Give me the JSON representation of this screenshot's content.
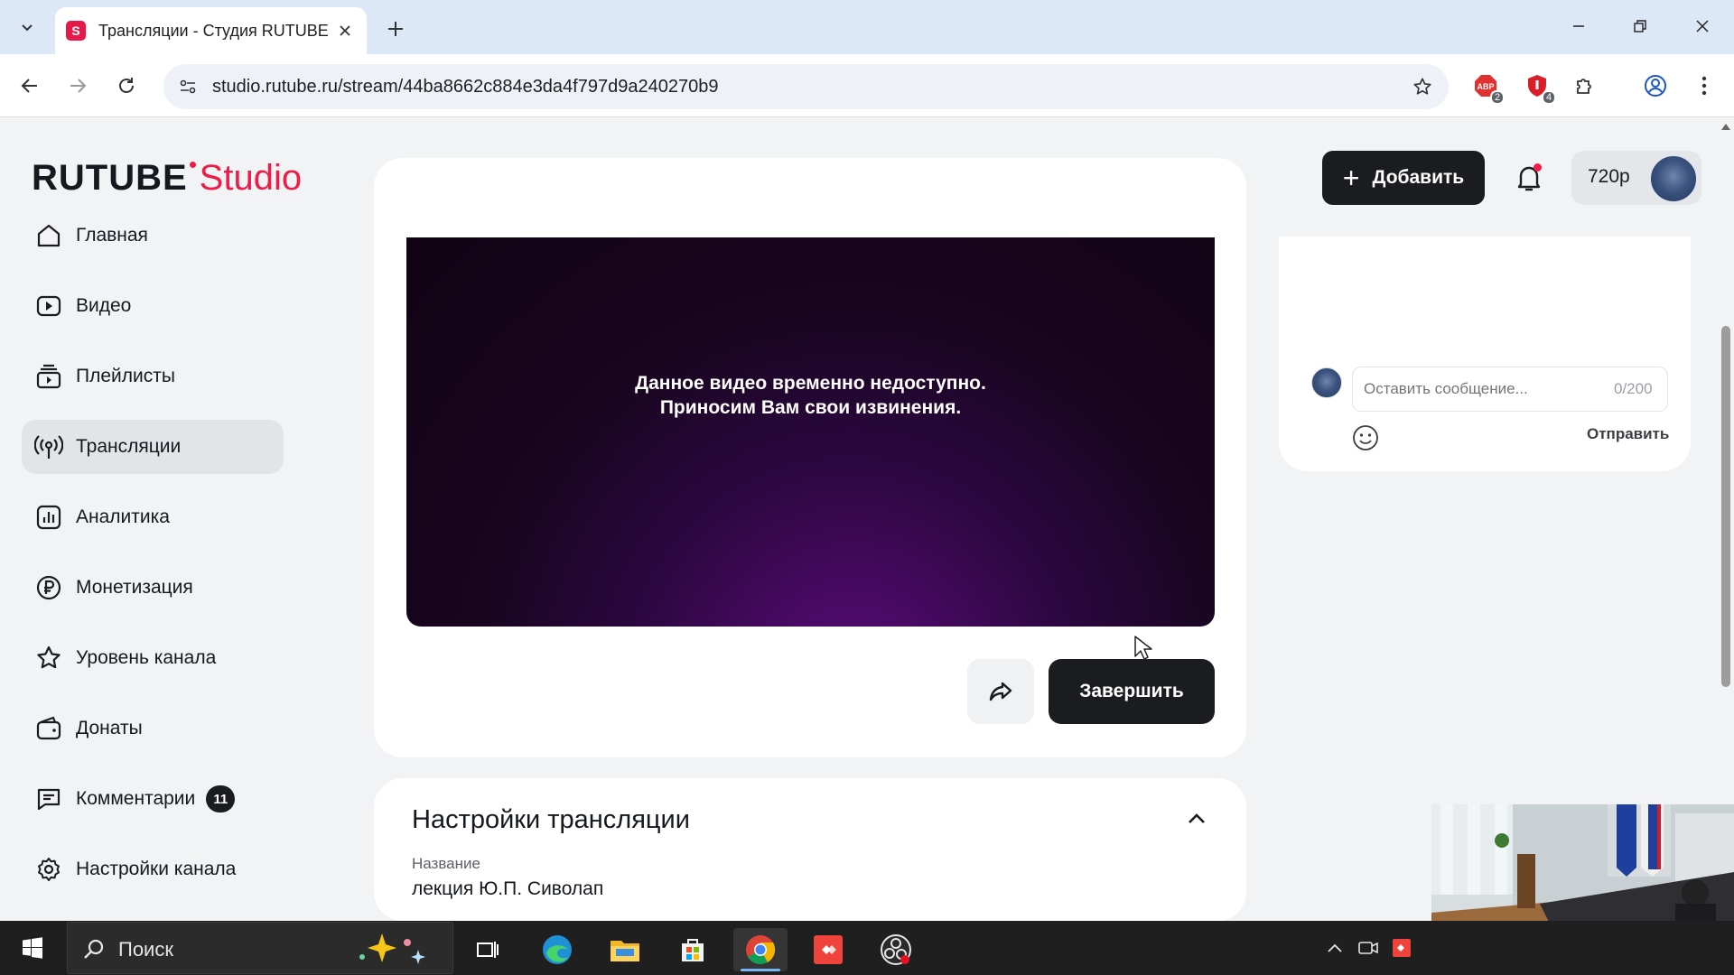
{
  "browser": {
    "tab_title": "Трансляции - Студия RUTUBE",
    "tab_favicon_letter": "S",
    "url": "studio.rutube.ru/stream/44ba8662c884e3da4f797d9a240270b9",
    "extensions": [
      {
        "name": "adblock-extension-icon",
        "badge": "2"
      },
      {
        "name": "shield-extension-icon",
        "badge": "4"
      }
    ]
  },
  "header": {
    "logo_main": "RUTUBE",
    "logo_studio": "Studio",
    "add_button": "Добавить",
    "profile_label": "720p"
  },
  "sidebar": {
    "items": [
      {
        "label": "Главная"
      },
      {
        "label": "Видео"
      },
      {
        "label": "Плейлисты"
      },
      {
        "label": "Трансляции",
        "active": true
      },
      {
        "label": "Аналитика"
      },
      {
        "label": "Монетизация"
      },
      {
        "label": "Уровень канала"
      },
      {
        "label": "Донаты"
      },
      {
        "label": "Комментарии",
        "badge": "11"
      },
      {
        "label": "Настройки канала"
      }
    ]
  },
  "video": {
    "message_line1": "Данное видео временно недоступно.",
    "message_line2": "Приносим Вам свои извинения."
  },
  "actions": {
    "finish_button": "Завершить"
  },
  "settings": {
    "title": "Настройки трансляции",
    "name_label": "Название",
    "name_value": "лекция Ю.П. Сиволап"
  },
  "chat": {
    "placeholder": "Оставить сообщение...",
    "counter": "0/200",
    "send_button": "Отправить"
  },
  "taskbar": {
    "search_text": "Поиск"
  },
  "colors": {
    "brand_red": "#ed1c48",
    "dark": "#1b1c1f",
    "page_bg": "#f2f3f5"
  }
}
